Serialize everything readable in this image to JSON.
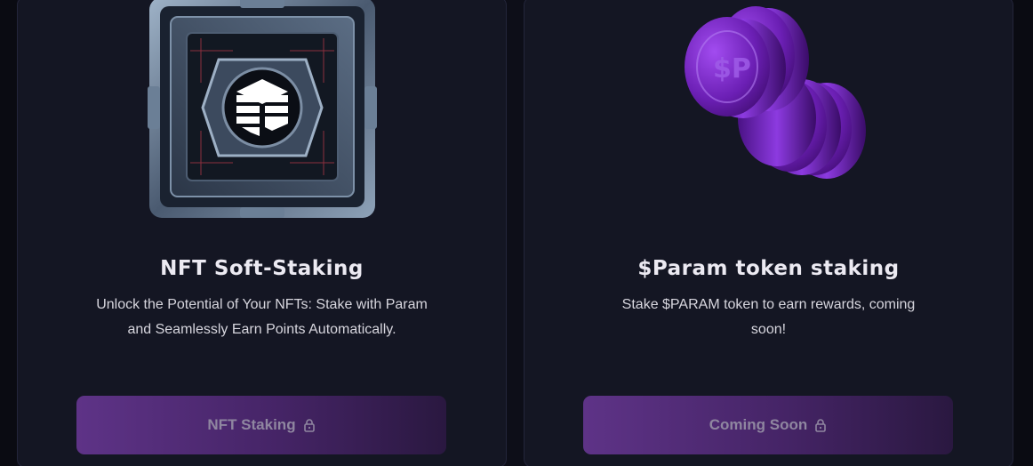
{
  "cards": [
    {
      "title": "NFT Soft-Staking",
      "description_lines": [
        "Unlock the Potential of Your NFTs: Stake with Param",
        "and Seamlessly Earn Points Automatically."
      ],
      "button_label": "NFT Staking",
      "button_icon": "lock-icon",
      "art": "nft-cube-emblem"
    },
    {
      "title": "$Param token staking",
      "description_lines": [
        "Stake $PARAM token to earn rewards, coming",
        "soon!"
      ],
      "button_label": "Coming Soon",
      "button_icon": "lock-icon",
      "art": "param-token-coins"
    }
  ],
  "colors": {
    "background": "#0d0e18",
    "card": "#141623",
    "accent": "#5e3387",
    "coin": "#7a2bc7"
  }
}
